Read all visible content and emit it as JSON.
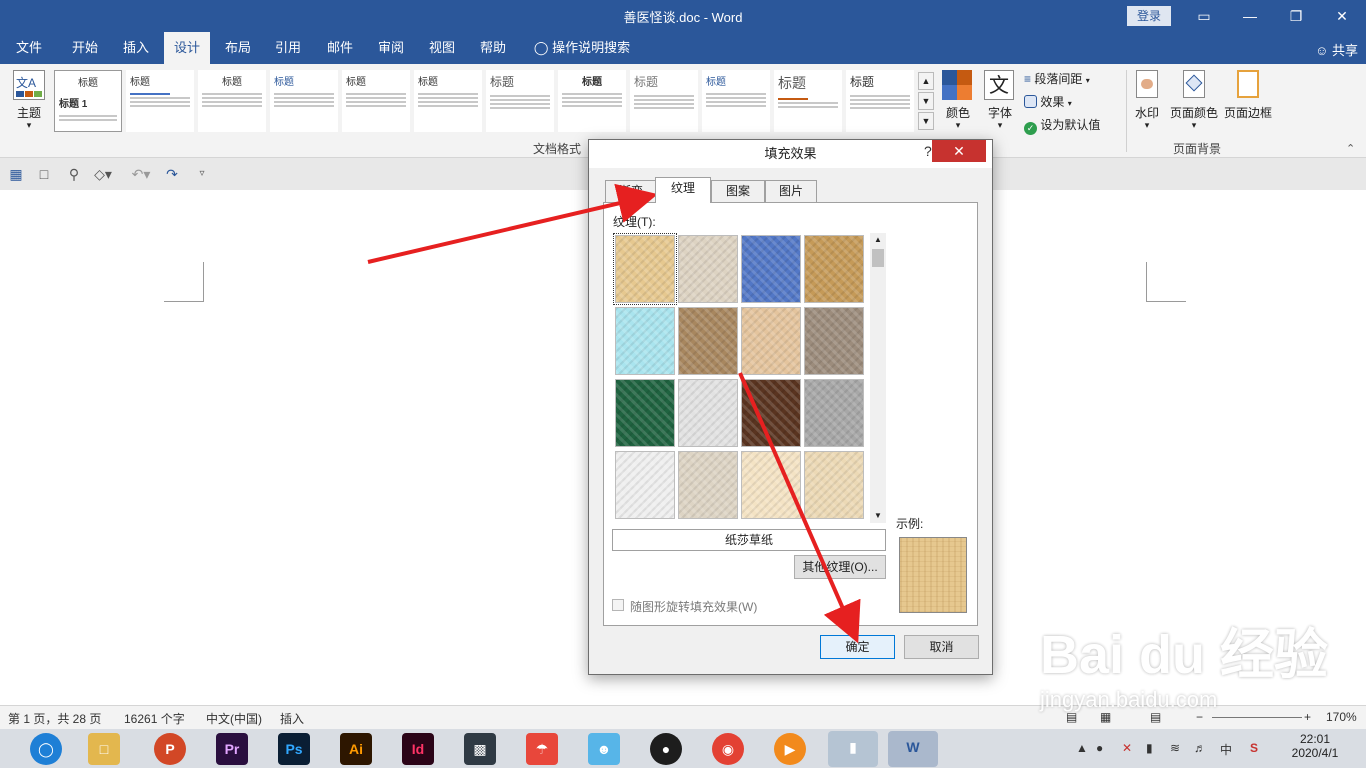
{
  "window": {
    "title": "善医怪谈.doc  -  Word",
    "login": "登录",
    "min": "—",
    "restore": "❐",
    "close": "✕",
    "ribbon_opts": "▭"
  },
  "menu": {
    "tabs": [
      "文件",
      "开始",
      "插入",
      "设计",
      "布局",
      "引用",
      "邮件",
      "审阅",
      "视图",
      "帮助"
    ],
    "tell_me": "操作说明搜索",
    "share": "共享"
  },
  "ribbon": {
    "theme_label": "主题",
    "group_doc_format": "文档格式",
    "style_headings": [
      "标题",
      "标题",
      "标题",
      "标题",
      "标题",
      "标题",
      "标题",
      "标题",
      "标题",
      "标题",
      "标题",
      "标题"
    ],
    "style_sub": "标题 1",
    "colors_label": "颜色",
    "fonts_label": "字体",
    "paragraph_spacing": "段落间距",
    "effects": "效果",
    "set_default": "设为默认值",
    "watermark": "水印",
    "page_color": "页面颜色",
    "page_borders": "页面边框",
    "group_page_background": "页面背景"
  },
  "status": {
    "page": "第 1 页，共 28 页",
    "words": "16261 个字",
    "lang": "中文(中国)",
    "mode": "插入",
    "zoom": "170%"
  },
  "taskbar": {
    "time": "22:01",
    "date": "2020/4/1",
    "ime": "中",
    "apps": [
      "P",
      "Pr",
      "Ps",
      "Ai",
      "Id",
      "W"
    ]
  },
  "dialog": {
    "title": "填充效果",
    "help": "?",
    "close": "✕",
    "tabs": [
      "渐变",
      "纹理",
      "图案",
      "图片"
    ],
    "texture_label": "纹理(T):",
    "selected_name": "纸莎草纸",
    "other_texture": "其他纹理(O)...",
    "sample_label": "示例:",
    "rotate_label": "随图形旋转填充效果(W)",
    "ok": "确定",
    "cancel": "取消",
    "textures": [
      "#e6c88f",
      "#ddd3c2",
      "#5277c6",
      "#c59a58",
      "#a9e4ee",
      "#a8875f",
      "#e4c49d",
      "#9c8c7c",
      "#1f6340",
      "#e2e2e2",
      "#5a3420",
      "#a7a7a7",
      "#efefef",
      "#ddd4c4",
      "#f4e3c4",
      "#ecd9b5"
    ]
  },
  "watermark": {
    "brand": "Bai du 经验",
    "url": "jingyan.baidu.com"
  }
}
